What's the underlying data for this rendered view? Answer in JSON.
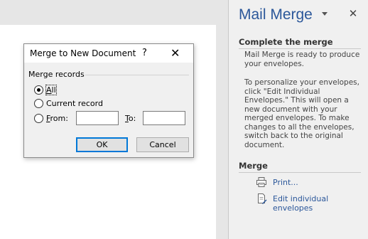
{
  "task_pane": {
    "title": "Mail Merge",
    "section_complete": {
      "heading": "Complete the merge",
      "para1": "Mail Merge is ready to produce your envelopes.",
      "para2": "To personalize your envelopes, click \"Edit Individual Envelopes.\" This will open a new document with your merged envelopes. To make changes to all the envelopes, switch back to the original document."
    },
    "section_merge": {
      "heading": "Merge",
      "links": [
        {
          "label": "Print...",
          "icon": "printer-icon"
        },
        {
          "label": "Edit individual envelopes",
          "icon": "edit-document-icon"
        }
      ]
    }
  },
  "dialog": {
    "title": "Merge to New Document",
    "help": "?",
    "close": "✕",
    "group_label": "Merge records",
    "options": [
      {
        "label": "All",
        "accel": "A",
        "rest": "ll",
        "checked": true
      },
      {
        "label": "Current record",
        "checked": false
      },
      {
        "label": "From:",
        "accel": "F",
        "rest": "rom:",
        "checked": false
      }
    ],
    "from_value": "",
    "to_label": "To:",
    "to_accel": "T",
    "to_rest": "o:",
    "to_value": "",
    "ok_label": "OK",
    "cancel_label": "Cancel"
  },
  "colors": {
    "accent": "#2b579a",
    "button_focus": "#0078d7"
  }
}
